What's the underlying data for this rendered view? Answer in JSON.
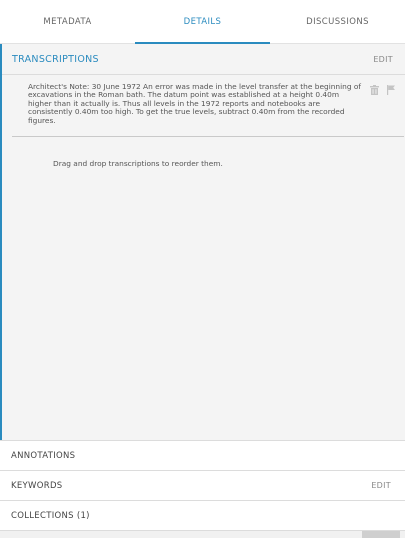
{
  "tabs": [
    {
      "label": "METADATA"
    },
    {
      "label": "DETAILS"
    },
    {
      "label": "DISCUSSIONS"
    }
  ],
  "active_tab": "DETAILS",
  "transcriptions": {
    "title": "TRANSCRIPTIONS",
    "edit_label": "EDIT",
    "items": [
      {
        "text": "Architect's Note: 30 June 1972 An error was made in the level transfer at the beginning of excavations in the Roman bath. The datum point was established at a height 0.40m higher than it actually is. Thus all levels in the 1972 reports and notebooks are consistently 0.40m too high. To get the true levels, subtract 0.40m from the recorded figures."
      }
    ],
    "hint": "Drag and drop transcriptions to reorder them."
  },
  "sections": {
    "annotations": {
      "title": "ANNOTATIONS"
    },
    "keywords": {
      "title": "KEYWORDS",
      "edit_label": "EDIT"
    },
    "collections": {
      "title": "COLLECTIONS (1)"
    }
  },
  "icons": {
    "delete": "trash-icon",
    "flag": "flag-icon"
  },
  "colors": {
    "accent": "#2a8bbf",
    "panel_bg": "#f4f4f4"
  }
}
